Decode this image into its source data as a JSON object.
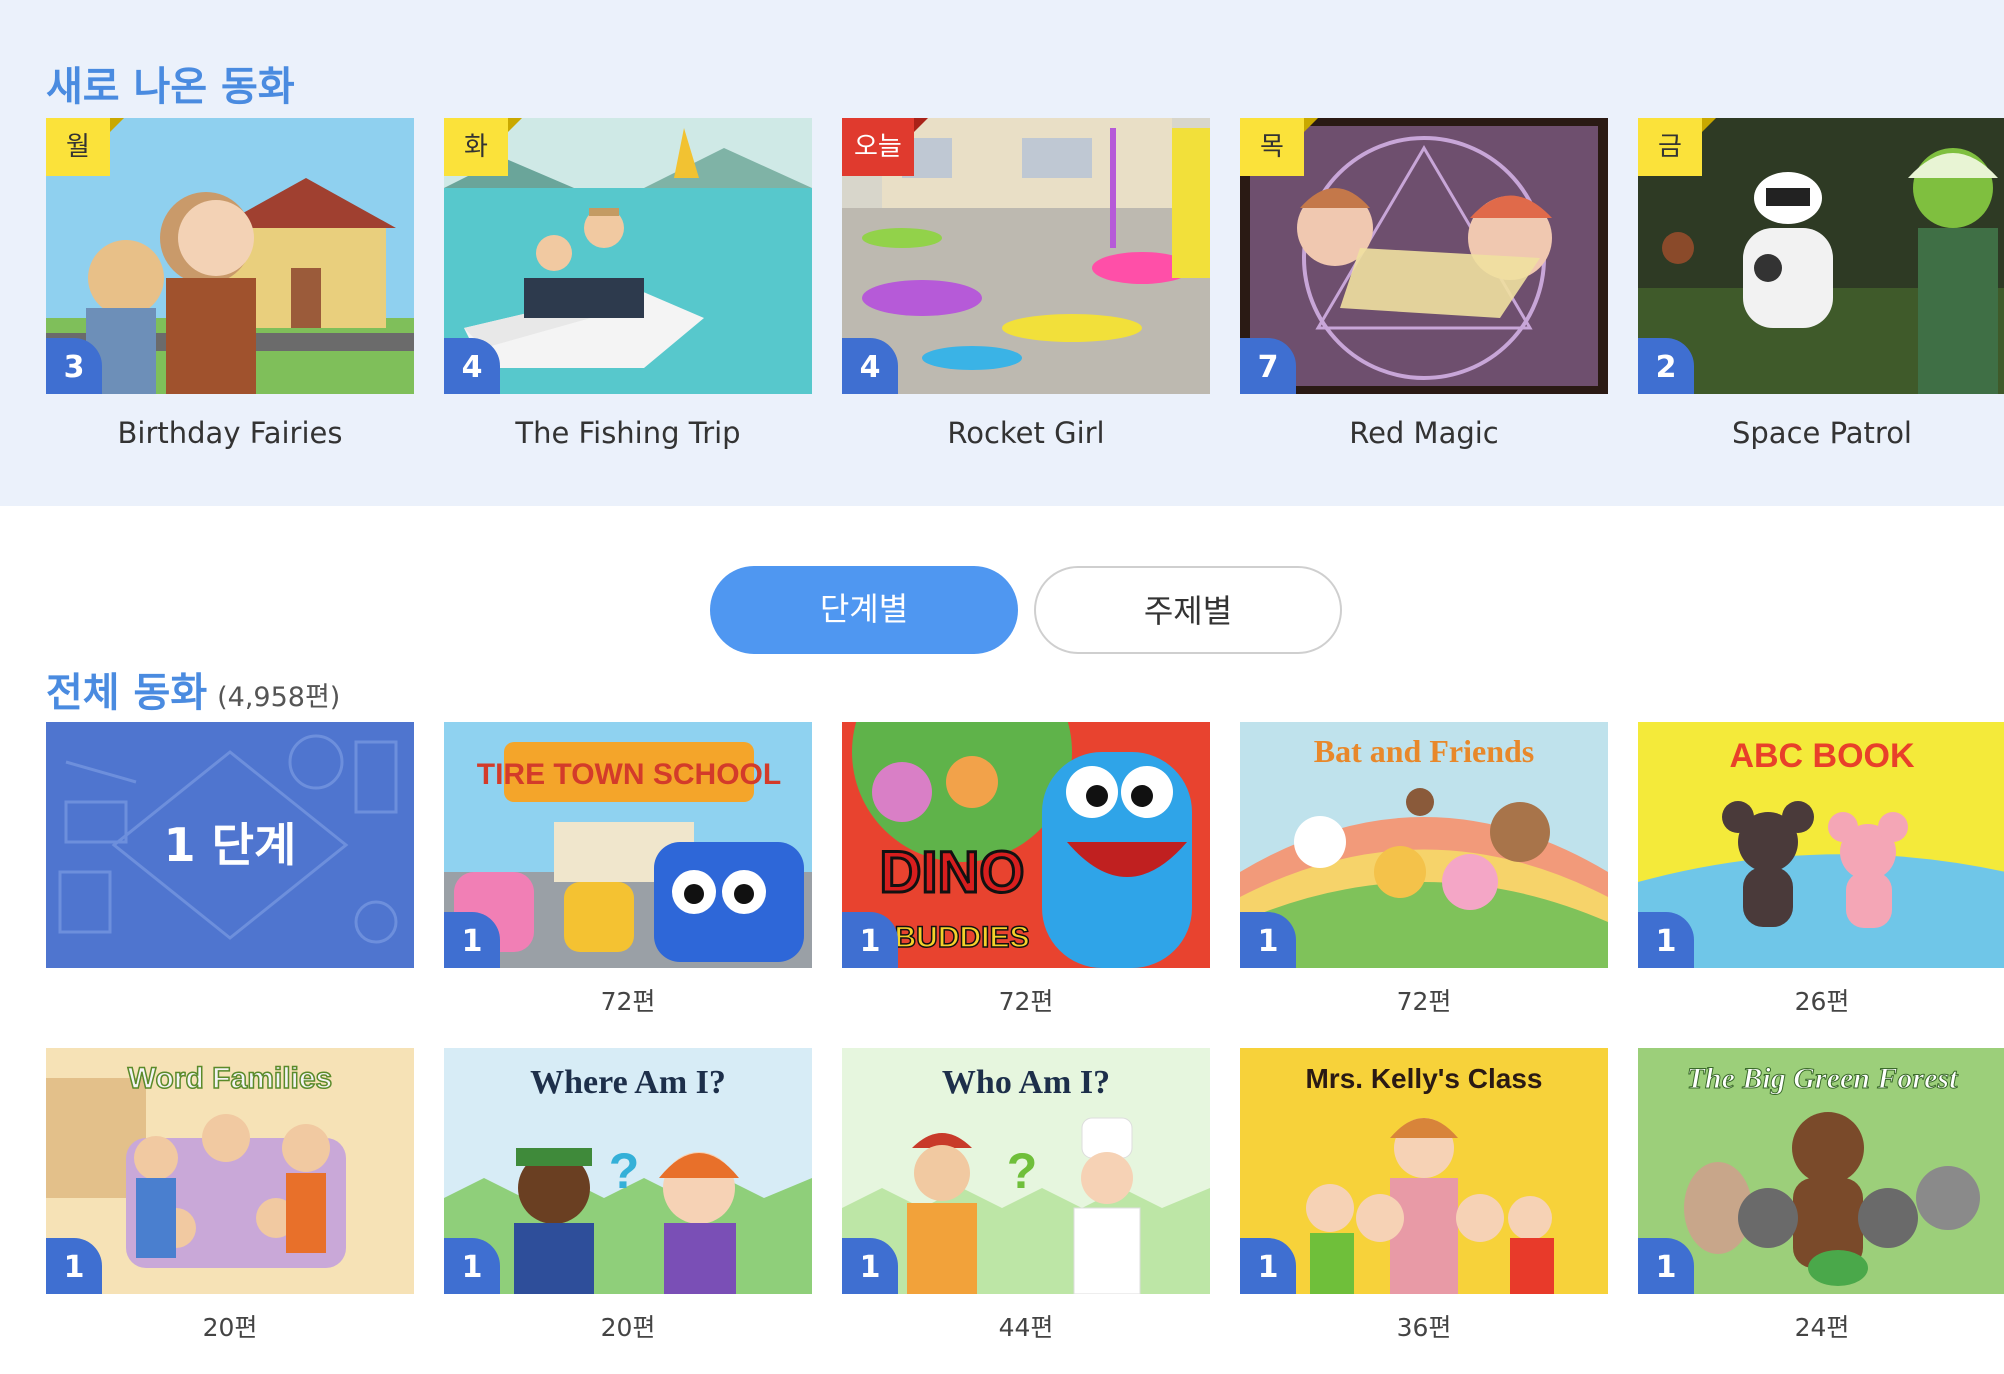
{
  "new_section": {
    "title": "새로 나온 동화",
    "cards": [
      {
        "day": "월",
        "level": "3",
        "title": "Birthday Fairies",
        "today": false
      },
      {
        "day": "화",
        "level": "4",
        "title": "The Fishing Trip",
        "today": false
      },
      {
        "day": "오늘",
        "level": "4",
        "title": "Rocket Girl",
        "today": true
      },
      {
        "day": "목",
        "level": "7",
        "title": "Red Magic",
        "today": false
      },
      {
        "day": "금",
        "level": "2",
        "title": "Space Patrol",
        "today": false
      }
    ]
  },
  "tabs": {
    "active": "단계별",
    "inactive": "주제별"
  },
  "all_section": {
    "title": "전체 동화",
    "count": "(4,958편)",
    "level_tile": "1 단계",
    "rows": [
      [
        {
          "series": "TIRE TOWN SCHOOL",
          "level": "1",
          "count": "72편"
        },
        {
          "series": "DINO BUDDIES",
          "level": "1",
          "count": "72편"
        },
        {
          "series": "Bat and Friends",
          "level": "1",
          "count": "72편"
        },
        {
          "series": "ABC BOOK",
          "level": "1",
          "count": "26편"
        }
      ],
      [
        {
          "series": "Word Families",
          "level": "1",
          "count": "20편"
        },
        {
          "series": "Where Am I?",
          "level": "1",
          "count": "20편"
        },
        {
          "series": "Who Am I?",
          "level": "1",
          "count": "44편"
        },
        {
          "series": "Mrs. Kelly's Class",
          "level": "1",
          "count": "36편"
        },
        {
          "series": "The Big Green Forest",
          "level": "1",
          "count": "24편"
        }
      ]
    ]
  }
}
